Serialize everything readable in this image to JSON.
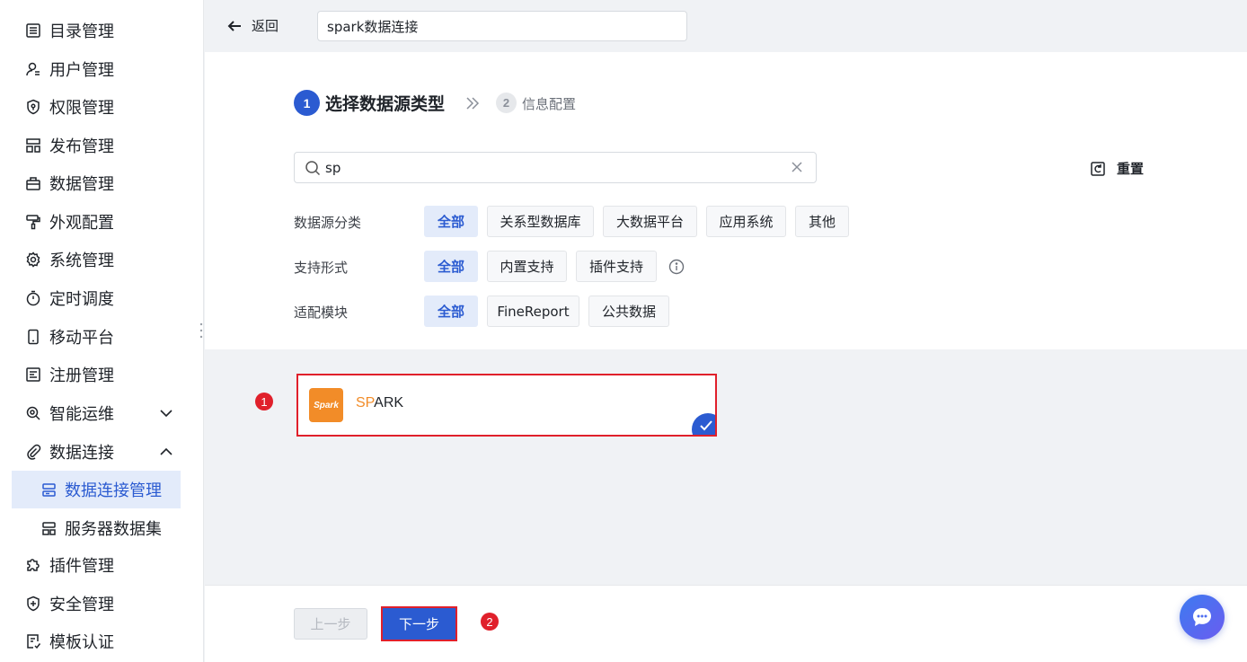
{
  "sidebar": {
    "items": [
      {
        "label": "目录管理",
        "icon": "list-icon"
      },
      {
        "label": "用户管理",
        "icon": "user-icon"
      },
      {
        "label": "权限管理",
        "icon": "shield-lock-icon"
      },
      {
        "label": "发布管理",
        "icon": "publish-icon"
      },
      {
        "label": "数据管理",
        "icon": "database-box-icon"
      },
      {
        "label": "外观配置",
        "icon": "paint-roller-icon"
      },
      {
        "label": "系统管理",
        "icon": "gear-icon"
      },
      {
        "label": "定时调度",
        "icon": "timer-icon"
      },
      {
        "label": "移动平台",
        "icon": "mobile-icon"
      },
      {
        "label": "注册管理",
        "icon": "register-icon"
      },
      {
        "label": "智能运维",
        "icon": "ops-icon"
      },
      {
        "label": "数据连接",
        "icon": "paperclip-icon"
      },
      {
        "label": "插件管理",
        "icon": "puzzle-icon"
      },
      {
        "label": "安全管理",
        "icon": "shield-plus-icon"
      },
      {
        "label": "模板认证",
        "icon": "certificate-icon"
      }
    ],
    "sub_items": [
      {
        "label": "数据连接管理",
        "icon": "server-icon",
        "active": true
      },
      {
        "label": "服务器数据集",
        "icon": "dataset-icon",
        "active": false
      }
    ]
  },
  "topbar": {
    "back_label": "返回",
    "name_value": "spark数据连接"
  },
  "steps": {
    "step1_num": "1",
    "step1_label": "选择数据源类型",
    "step2_num": "2",
    "step2_label": "信息配置"
  },
  "search": {
    "value": "sp"
  },
  "reset_label": "重置",
  "filters": {
    "category": {
      "label": "数据源分类",
      "options": [
        "全部",
        "关系型数据库",
        "大数据平台",
        "应用系统",
        "其他"
      ],
      "selected": "全部"
    },
    "support": {
      "label": "支持形式",
      "options": [
        "全部",
        "内置支持",
        "插件支持"
      ],
      "selected": "全部"
    },
    "module": {
      "label": "适配模块",
      "options": [
        "全部",
        "FineReport",
        "公共数据"
      ],
      "selected": "全部"
    }
  },
  "card": {
    "logo_text": "Spark",
    "title_highlight": "SP",
    "title_rest": "ARK"
  },
  "markers": {
    "m1": "1",
    "m2": "2"
  },
  "footer": {
    "prev_label": "上一步",
    "next_label": "下一步"
  },
  "colors": {
    "primary": "#2b5bd1",
    "annotation_red": "#e0202b",
    "spark_orange": "#f28c28",
    "active_bg": "#e3ebfa"
  }
}
